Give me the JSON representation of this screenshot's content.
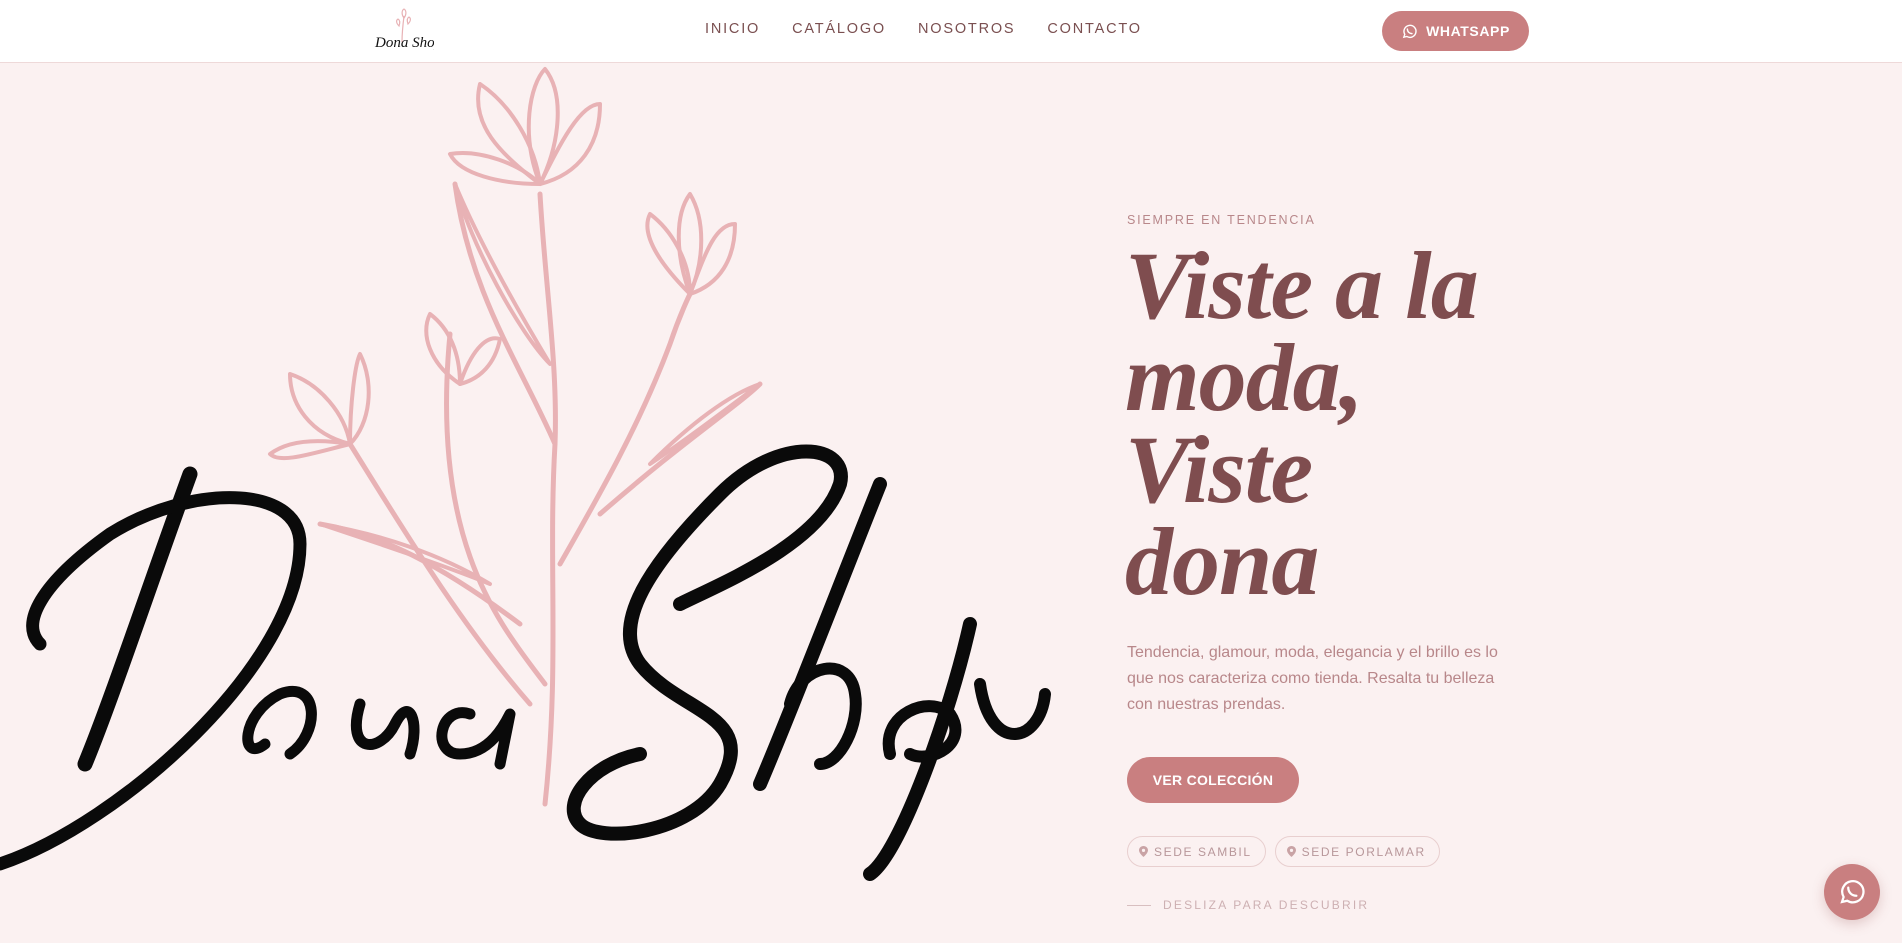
{
  "brand": {
    "logo_text": "Dona Shop",
    "hero_wordmark": "Dona Shop"
  },
  "nav": {
    "items": [
      {
        "label": "INICIO"
      },
      {
        "label": "CATÁLOGO"
      },
      {
        "label": "NOSOTROS"
      },
      {
        "label": "CONTACTO"
      }
    ]
  },
  "header": {
    "whatsapp_label": "WHATSAPP",
    "whatsapp_icon": "whatsapp-icon"
  },
  "hero": {
    "eyebrow": "SIEMPRE EN TENDENCIA",
    "headline": [
      "Viste a la",
      "moda,",
      "Viste",
      "dona"
    ],
    "description": "Tendencia, glamour, moda, elegancia y el brillo es lo que nos caracteriza como tienda. Resalta tu belleza con nuestras prendas.",
    "cta_label": "VER COLECCIÓN",
    "locations": [
      {
        "label": "SEDE SAMBIL",
        "icon": "location-pin-icon"
      },
      {
        "label": "SEDE PORLAMAR",
        "icon": "location-pin-icon"
      }
    ],
    "scroll_hint": "DESLIZA PARA DESCUBRIR"
  },
  "floating": {
    "icon": "whatsapp-icon"
  },
  "colors": {
    "accent": "#c97f80",
    "headline": "#7f4d4f",
    "muted_text": "#b8878a",
    "background": "#fbf1f1",
    "flower": "#e8b2b5"
  }
}
